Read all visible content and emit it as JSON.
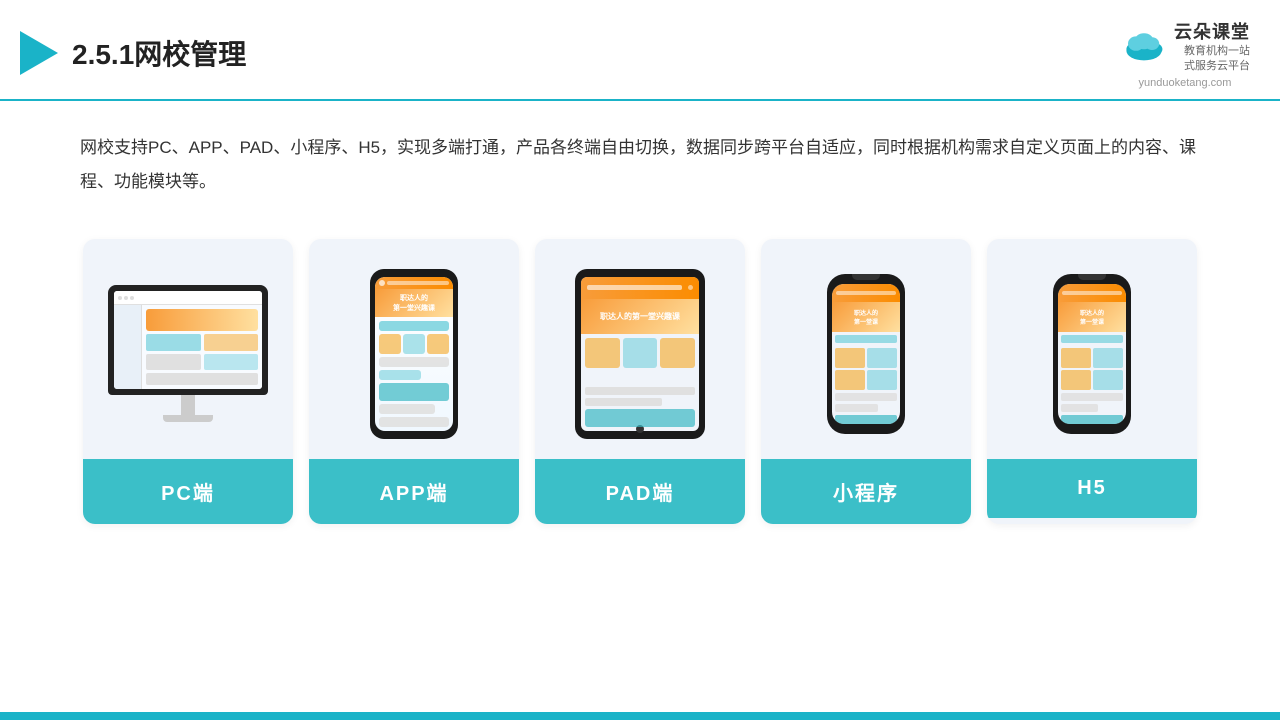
{
  "header": {
    "title": "2.5.1网校管理",
    "logo_name": "云朵课堂",
    "logo_tagline": "教育机构一站\n式服务云平台",
    "logo_url": "yunduoketang.com"
  },
  "description": {
    "text": "网校支持PC、APP、PAD、小程序、H5，实现多端打通，产品各终端自由切换，数据同步跨平台自适应，同时根据机构需求自定义页面上的内容、课程、功能模块等。"
  },
  "cards": [
    {
      "id": "pc",
      "label": "PC端"
    },
    {
      "id": "app",
      "label": "APP端"
    },
    {
      "id": "pad",
      "label": "PAD端"
    },
    {
      "id": "miniprogram",
      "label": "小程序"
    },
    {
      "id": "h5",
      "label": "H5"
    }
  ],
  "colors": {
    "accent": "#1ab3c8",
    "card_bg": "#eef2fa",
    "label_bg": "#3bbfc8",
    "text_primary": "#222",
    "text_body": "#333"
  }
}
